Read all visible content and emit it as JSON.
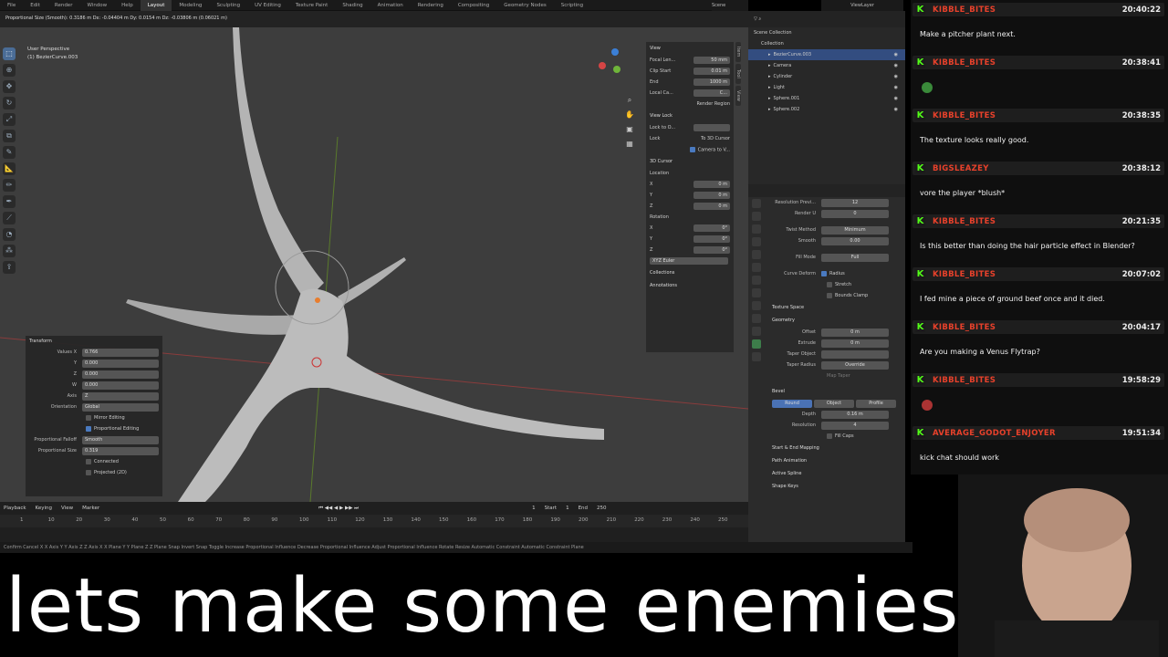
{
  "topbar": {
    "menus": [
      "File",
      "Edit",
      "Render",
      "Window",
      "Help"
    ],
    "workspaces": [
      "Layout",
      "Modeling",
      "Sculpting",
      "UV Editing",
      "Texture Paint",
      "Shading",
      "Animation",
      "Rendering",
      "Compositing",
      "Geometry Nodes",
      "Scripting"
    ],
    "active": "Layout",
    "scene": "Scene",
    "view_layer": "ViewLayer"
  },
  "infobar": {
    "text": "Proportional Size (Smooth): 0.3186 m  Dx: -0.04404 m  Dy: 0.0154 m  Dz: -0.03806 m (0.06021 m)"
  },
  "viewport": {
    "perspective": "User Perspective",
    "object": "(1) BezierCurve.003"
  },
  "npanel": {
    "view_title": "View",
    "focal_label": "Focal Len...",
    "focal": "50 mm",
    "clip_start_label": "Clip Start",
    "clip_start": "0.01 m",
    "end_label": "End",
    "end": "1000 m",
    "local_camera_label": "Local Ca...",
    "local_camera_value": "C...",
    "render_region": "Render Region",
    "view_lock_title": "View Lock",
    "lock_to_label": "Lock to O...",
    "lock_label": "Lock",
    "to_cursor": "To 3D Cursor",
    "camera_to_view": "Camera to V...",
    "cursor_title": "3D Cursor",
    "location_label": "Location",
    "rotation_label": "Rotation",
    "x": "X",
    "y": "Y",
    "z": "Z",
    "zero_m": "0 m",
    "zero_deg": "0°",
    "rotation_mode": "XYZ Euler",
    "collections": "Collections",
    "annotations": "Annotations",
    "tabs": [
      "Item",
      "Tool",
      "View"
    ]
  },
  "operator": {
    "title": "Transform",
    "values_label": "Values X",
    "x": "0.766",
    "y_label": "Y",
    "y": "0.000",
    "z_label": "Z",
    "z": "0.000",
    "w_label": "W",
    "w": "0.000",
    "axis_label": "Axis",
    "axis": "Z",
    "orientation_label": "Orientation",
    "orientation": "Global",
    "mirror": "Mirror Editing",
    "proportional": "Proportional Editing",
    "falloff_label": "Proportional Falloff",
    "falloff": "Smooth",
    "size_label": "Proportional Size",
    "size": "0.319",
    "connected": "Connected",
    "projected": "Projected (2D)"
  },
  "timeline": {
    "playback": "Playback",
    "keying": "Keying",
    "view": "View",
    "marker": "Marker",
    "current": "1",
    "start_label": "Start",
    "start": "1",
    "end_label": "End",
    "end": "250",
    "ticks": [
      "1",
      "10",
      "20",
      "30",
      "40",
      "50",
      "60",
      "70",
      "80",
      "90",
      "100",
      "110",
      "120",
      "130",
      "140",
      "150",
      "160",
      "170",
      "180",
      "190",
      "200",
      "210",
      "220",
      "230",
      "240",
      "250"
    ]
  },
  "statusbar": {
    "text": "Confirm   Cancel   X X Axis   Y Y Axis   Z Z Axis   X X Plane   Y Y Plane   Z Z Plane   Snap Invert   Snap Toggle   Increase Proportional Influence   Decrease Proportional Influence   Adjust Proportional Influence   Rotate   Resize   Automatic Constraint   Automatic Constraint Plane"
  },
  "outliner": {
    "scene_collection": "Scene Collection",
    "collection": "Collection",
    "items": [
      "BezierCurve.003",
      "Camera",
      "Cylinder",
      "Light",
      "Sphere.001",
      "Sphere.002"
    ],
    "selected": "BezierCurve.003"
  },
  "properties": {
    "res_preview_label": "Resolution Previ...",
    "res_preview": "12",
    "render_u_label": "Render U",
    "render_u": "0",
    "twist_label": "Twist Method",
    "twist": "Minimum",
    "smooth_label": "Smooth",
    "smooth": "0.00",
    "fill_label": "Fill Mode",
    "fill": "Full",
    "deform_label": "Curve Deform",
    "radius": "Radius",
    "stretch": "Stretch",
    "bounds_clamp": "Bounds Clamp",
    "texture_space": "Texture Space",
    "geometry": "Geometry",
    "offset_label": "Offset",
    "offset": "0 m",
    "extrude_label": "Extrude",
    "extrude": "0 m",
    "taper_obj_label": "Taper Object",
    "taper_radius_label": "Taper Radius",
    "taper_radius": "Override",
    "map_taper": "Map Taper",
    "bevel": "Bevel",
    "bevel_round": "Round",
    "bevel_object": "Object",
    "bevel_profile": "Profile",
    "depth_label": "Depth",
    "depth": "0.16 m",
    "resolution_label": "Resolution",
    "resolution": "4",
    "fill_caps": "Fill Caps",
    "start_end": "Start & End Mapping",
    "path_anim": "Path Animation",
    "active_spline": "Active Spline",
    "shape_keys": "Shape Keys"
  },
  "chat": [
    {
      "user": "KIBBLE_BITES",
      "time": "20:40:22",
      "text": "Make a pitcher plant next."
    },
    {
      "user": "KIBBLE_BITES",
      "time": "20:38:41",
      "text": ""
    },
    {
      "user": "KIBBLE_BITES",
      "time": "20:38:35",
      "text": "The texture looks really good."
    },
    {
      "user": "BIGSLEAZEY",
      "time": "20:38:12",
      "text": "vore the player *blush*"
    },
    {
      "user": "KIBBLE_BITES",
      "time": "20:21:35",
      "text": "Is this better than doing the hair particle effect in Blender?"
    },
    {
      "user": "KIBBLE_BITES",
      "time": "20:07:02",
      "text": "I fed mine a piece of ground beef once and it died."
    },
    {
      "user": "KIBBLE_BITES",
      "time": "20:04:17",
      "text": "Are you making a Venus Flytrap?"
    },
    {
      "user": "KIBBLE_BITES",
      "time": "19:58:29",
      "text": ""
    },
    {
      "user": "AVERAGE_GODOT_ENJOYER",
      "time": "19:51:34",
      "text": "kick chat should work"
    }
  ],
  "chat_badge": "K",
  "caption": "lets make some enemies"
}
